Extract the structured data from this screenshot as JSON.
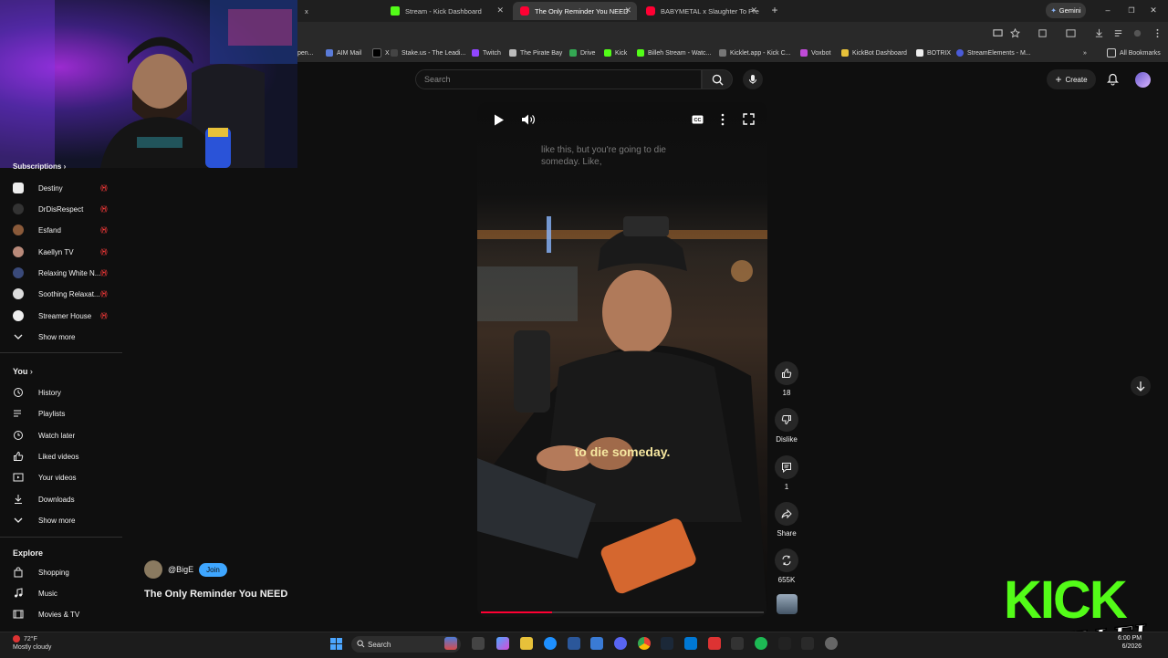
{
  "browser": {
    "tabs": [
      {
        "label": "x",
        "active": false
      },
      {
        "label": "Stream - Kick Dashboard",
        "active": false
      },
      {
        "label": "The Only Reminder You NEED",
        "active": true
      },
      {
        "label": "BABYMETAL x Slaughter To Pre",
        "active": false
      }
    ],
    "new_tab": "+",
    "profile_label": "Gemini",
    "bookmarks": [
      "pen...",
      "AIM Mail",
      "X",
      "Stake.us - The Leadi...",
      "Twitch",
      "The Pirate Bay",
      "Drive",
      "Kick",
      "Billeh Stream - Watc...",
      "Kicklet.app - Kick C...",
      "Voxbot",
      "KickBot Dashboard",
      "BOTRIX",
      "StreamElements - M..."
    ],
    "bookmarks_more": "»",
    "all_bookmarks": "All Bookmarks"
  },
  "masthead": {
    "search_placeholder": "Search",
    "create_label": "Create"
  },
  "sidebar": {
    "subscriptions_heading": "Subscriptions",
    "subscriptions": [
      {
        "label": "Destiny",
        "live": "((•))"
      },
      {
        "label": "DrDisRespect",
        "live": "((•))"
      },
      {
        "label": "Esfand",
        "live": "((•))"
      },
      {
        "label": "Kaellyn TV",
        "live": "((•))"
      },
      {
        "label": "Relaxing White N...",
        "live": "((•))"
      },
      {
        "label": "Soothing Relaxat...",
        "live": "((•))"
      },
      {
        "label": "Streamer House",
        "live": "((•))"
      }
    ],
    "show_more": "Show more",
    "you_heading": "You",
    "you_items": [
      "History",
      "Playlists",
      "Watch later",
      "Liked videos",
      "Your videos",
      "Downloads"
    ],
    "show_more_2": "Show more",
    "explore_heading": "Explore",
    "explore_items": [
      "Shopping",
      "Music",
      "Movies & TV"
    ]
  },
  "player": {
    "subtitle_top": "like this, but you're going to die someday. Like,",
    "subtitle_main": "to die someday.",
    "progress": 0.25
  },
  "actions": {
    "likes": "18",
    "dislike": "Dislike",
    "comments": "1",
    "share": "Share",
    "remix": "655K"
  },
  "channel": {
    "handle": "@BigE",
    "join": "Join",
    "title": "The Only Reminder You NEED"
  },
  "taskbar": {
    "temp": "72°F",
    "weather": "Mostly cloudy",
    "search": "Search",
    "time": "6:00 PM",
    "date": "6/2026"
  },
  "overlay": {
    "kick": "KICK",
    "billeh": "BILLEH"
  },
  "colors": {
    "accent_red": "#ff0033",
    "join_blue": "#3ea6ff",
    "kick_green": "#53fc18"
  }
}
